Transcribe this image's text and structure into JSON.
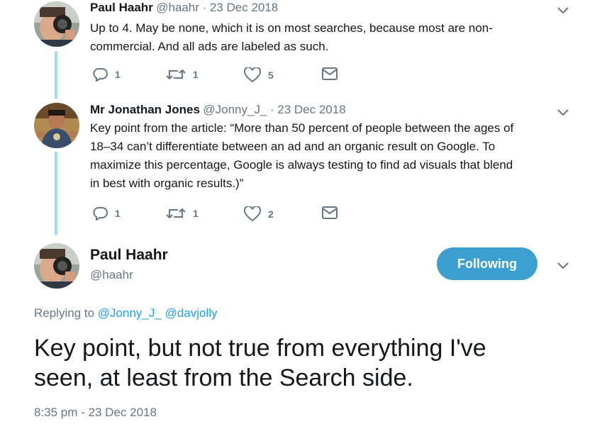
{
  "tweets": [
    {
      "name": "Paul Haahr",
      "handle": "@haahr",
      "date": "· 23 Dec 2018",
      "lines": [
        "Up to 4. May be none, which it is on most searches, because most are non-",
        "commercial. And all ads are labeled as such."
      ],
      "replies": "1",
      "retweets": "1",
      "likes": "5"
    },
    {
      "name": "Mr Jonathan Jones",
      "handle": "@Jonny_J_",
      "date": "· 23 Dec 2018",
      "lines": [
        "Key point from the article: “More than 50 percent of people between the ages of",
        "18–34 can’t differentiate between an ad and an organic result on Google. To",
        "maximize this percentage, Google is always testing to find ad visuals that blend",
        "in best with organic results.)”"
      ],
      "replies": "1",
      "retweets": "1",
      "likes": "2"
    }
  ],
  "main": {
    "name": "Paul Haahr",
    "handle": "@haahr",
    "follow_label": "Following",
    "replying_prefix": "Replying to",
    "mentions": [
      "@Jonny_J_",
      "@davjolly"
    ],
    "text_lines": [
      "Key point, but not true from everything I've",
      "seen, at least from the Search side."
    ],
    "timestamp": "8:35 pm - 23 Dec 2018"
  },
  "colors": {
    "accent": "#1da1f2",
    "follow_button": "#3d9fd0",
    "thread_line": "#a4d9f2",
    "secondary_text": "#657786"
  },
  "icons": [
    "reply-icon",
    "retweet-icon",
    "like-icon",
    "direct-message-icon",
    "chevron-down-icon"
  ]
}
